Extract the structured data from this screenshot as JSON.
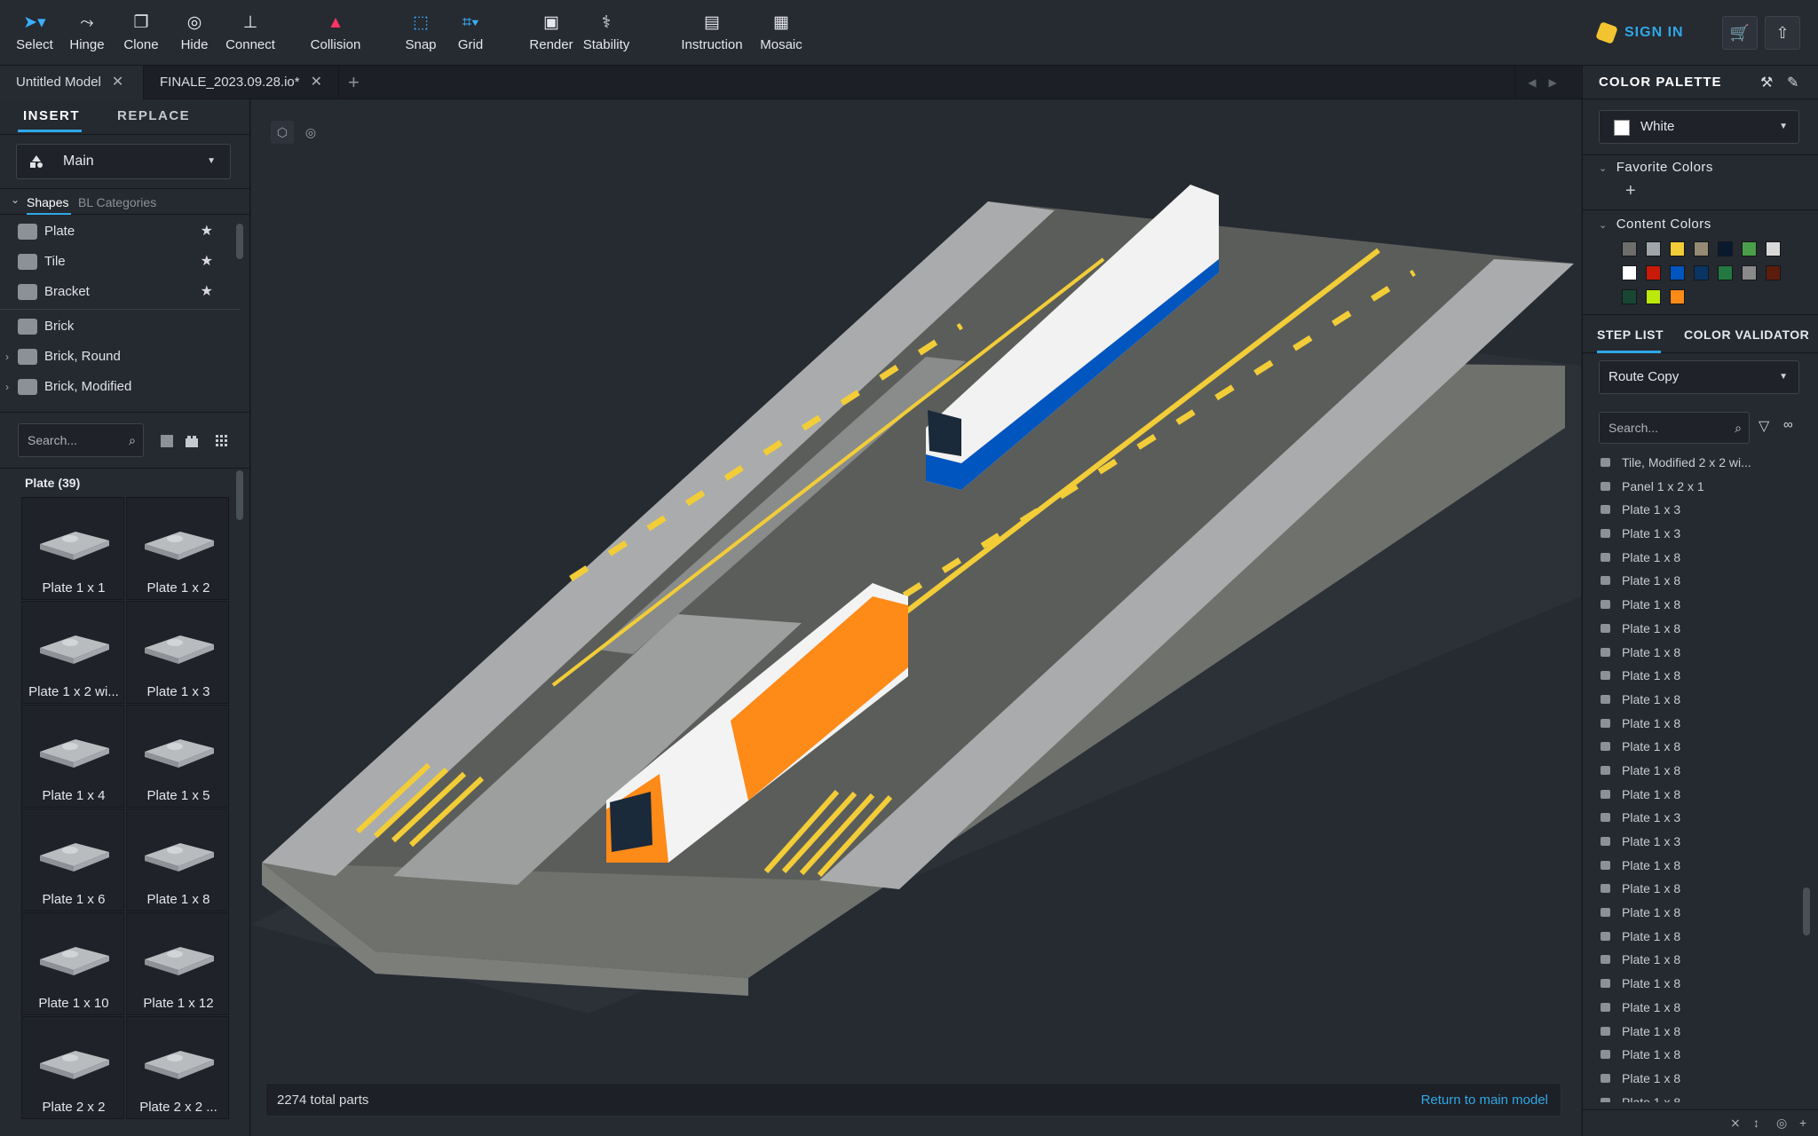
{
  "toolbar": {
    "tools": [
      {
        "label": "Select",
        "icon": "cursor-icon"
      },
      {
        "label": "Hinge",
        "icon": "hinge-icon"
      },
      {
        "label": "Clone",
        "icon": "clone-icon"
      },
      {
        "label": "Hide",
        "icon": "eye-off-icon"
      },
      {
        "label": "Connect",
        "icon": "connect-icon"
      },
      {
        "label": "Collision",
        "icon": "warning-icon"
      },
      {
        "label": "Snap",
        "icon": "snap-icon"
      },
      {
        "label": "Grid",
        "icon": "grid-icon"
      },
      {
        "label": "Render",
        "icon": "camera-icon"
      },
      {
        "label": "Stability",
        "icon": "stability-icon"
      },
      {
        "label": "Instruction",
        "icon": "book-icon"
      },
      {
        "label": "Mosaic",
        "icon": "mosaic-icon"
      }
    ],
    "sign_in": "SIGN IN"
  },
  "tabs": [
    {
      "label": "Untitled Model"
    },
    {
      "label": "FINALE_2023.09.28.io*"
    }
  ],
  "left_panel": {
    "insert": "INSERT",
    "replace": "REPLACE",
    "library": "Main",
    "sub_tabs": {
      "shapes": "Shapes",
      "bl": "BL Categories"
    },
    "favorites": [
      "Plate",
      "Tile",
      "Bracket"
    ],
    "categories": [
      "Brick",
      "Brick, Round",
      "Brick, Modified"
    ],
    "search_placeholder": "Search...",
    "group_title": "Plate (39)",
    "parts": [
      "Plate 1 x 1",
      "Plate 1 x 2",
      "Plate 1 x 2 wi...",
      "Plate 1 x 3",
      "Plate 1 x 4",
      "Plate 1 x 5",
      "Plate 1 x 6",
      "Plate 1 x 8",
      "Plate 1 x 10",
      "Plate 1 x 12",
      "Plate 2 x 2",
      "Plate 2 x 2 ..."
    ]
  },
  "viewport": {
    "part_count": "2274 total parts",
    "return_link": "Return to main model"
  },
  "right_panel": {
    "palette_title": "COLOR PALETTE",
    "selected_color": "White",
    "favorite_colors": "Favorite Colors",
    "content_colors": "Content Colors",
    "colors": [
      "#6d6e6c",
      "#a0a5a9",
      "#f2cd37",
      "#958a73",
      "#0a1a2e",
      "#4b9f4a",
      "#d9d9d9",
      "#ffffff",
      "#c91a09",
      "#0055bf",
      "#0a3463",
      "#237841",
      "#8a8a8a",
      "#5c1d0d",
      "#184632",
      "#bbe90b",
      "#fe8a18"
    ],
    "step_list": "STEP LIST",
    "color_validator": "COLOR VALIDATOR",
    "step_select": "Route Copy",
    "search_placeholder": "Search...",
    "steps": [
      "Tile, Modified 2 x 2 wi...",
      "Panel 1 x 2 x 1",
      "Plate 1 x 3",
      "Plate 1 x 3",
      "Plate 1 x 8",
      "Plate 1 x 8",
      "Plate 1 x 8",
      "Plate 1 x 8",
      "Plate 1 x 8",
      "Plate 1 x 8",
      "Plate 1 x 8",
      "Plate 1 x 8",
      "Plate 1 x 8",
      "Plate 1 x 8",
      "Plate 1 x 8",
      "Plate 1 x 3",
      "Plate 1 x 3",
      "Plate 1 x 8",
      "Plate 1 x 8",
      "Plate 1 x 8",
      "Plate 1 x 8",
      "Plate 1 x 8",
      "Plate 1 x 8",
      "Plate 1 x 8",
      "Plate 1 x 8",
      "Plate 1 x 8",
      "Plate 1 x 8",
      "Plate 1 x 8"
    ]
  }
}
